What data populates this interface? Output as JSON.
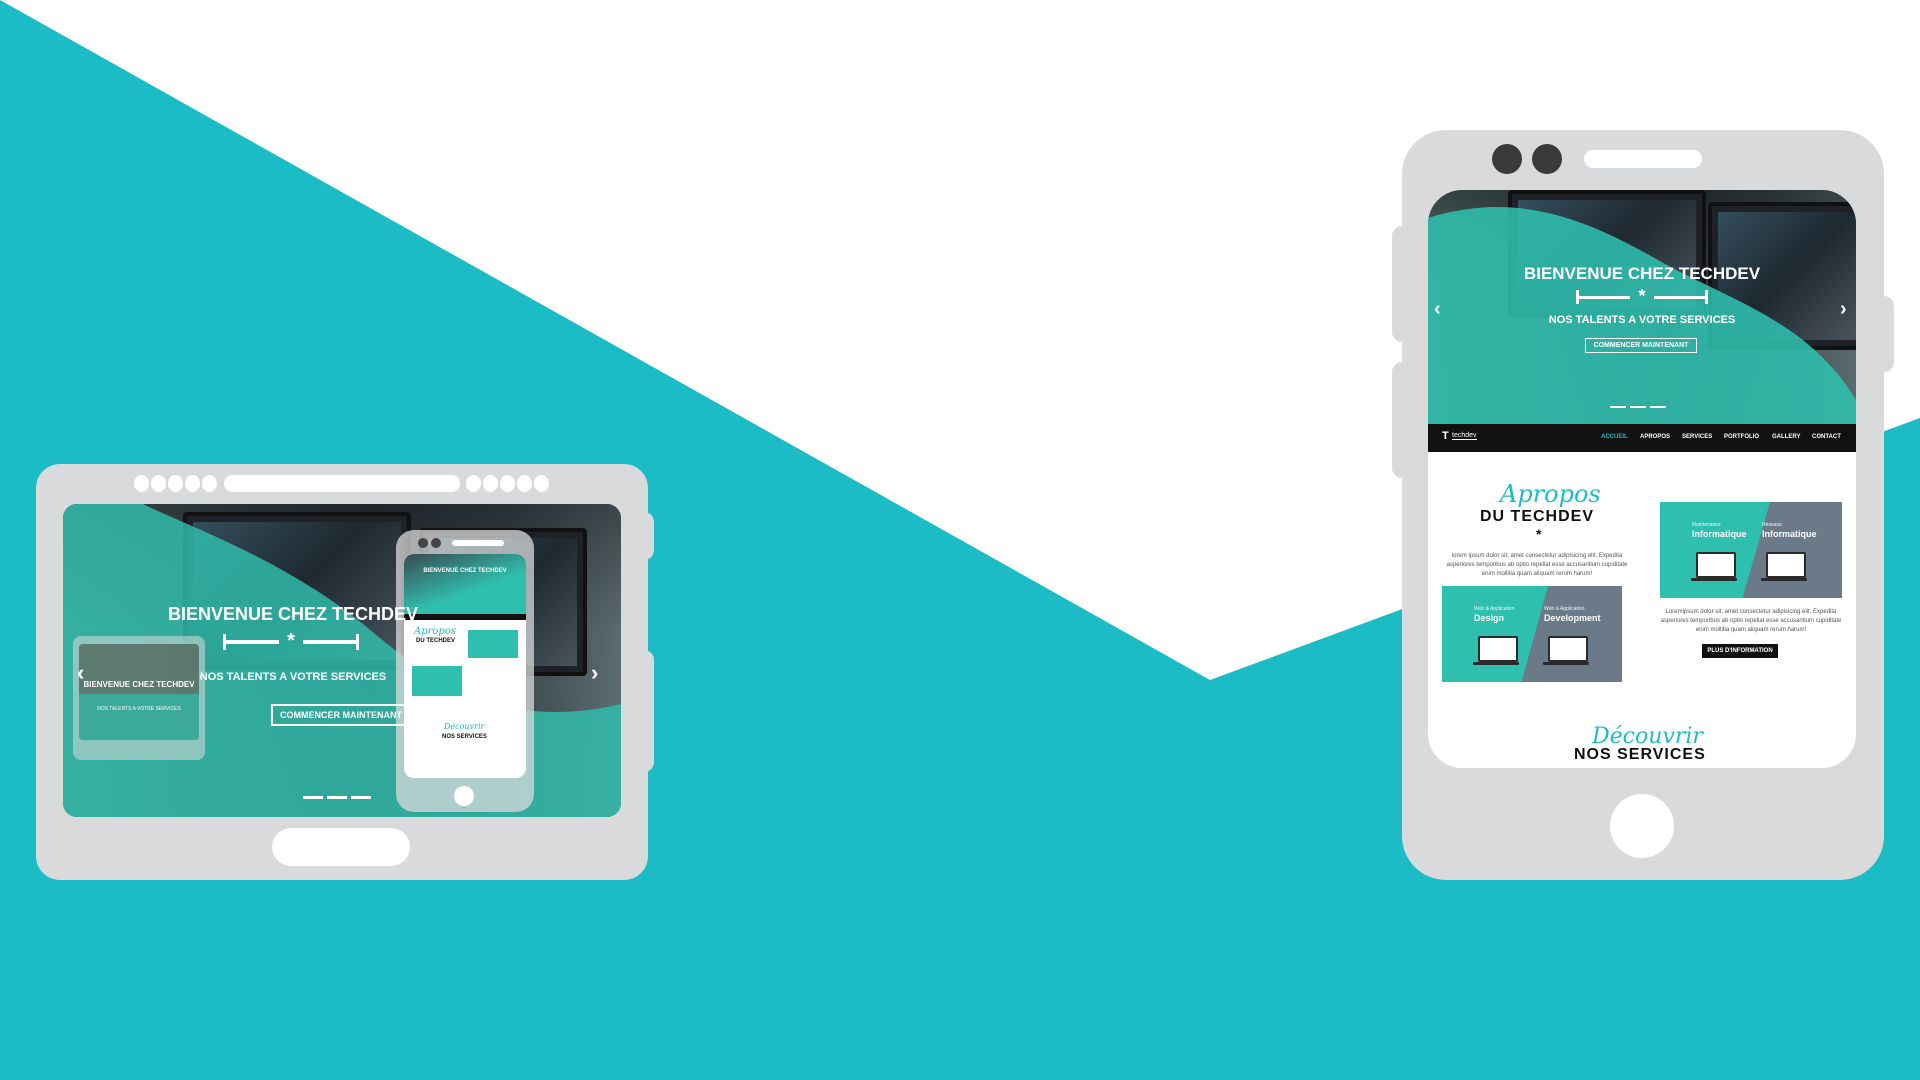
{
  "colors": {
    "teal": "#1bbcc5",
    "device_gray": "#d9dadb",
    "hero_teal": "#2fbfae",
    "slate": "#6b7a89"
  },
  "tablet": {
    "hero_title": "BIENVENUE CHEZ TECHDEV",
    "hero_subtitle": "NOS TALENTS A VOTRE SERVICES",
    "cta_label": "COMMENCER MAINTENANT",
    "ornament": "*",
    "prev_arrow": "‹",
    "next_arrow": "›",
    "mini_title": "BIENVENUE CHEZ TECHDEV",
    "mini_subtitle": "NOS TALENTS A VOTRE SERVICES",
    "mini_phone_title": "BIENVENUE CHEZ TECHDEV",
    "mini_apropos": "Apropos",
    "mini_du_techdev": "DU TECHDEV",
    "mini_decouvrir": "Découvrir",
    "mini_nos_services": "NOS SERVICES"
  },
  "phone": {
    "hero_title": "BIENVENUE CHEZ TECHDEV",
    "hero_subtitle": "NOS TALENTS A VOTRE SERVICES",
    "cta_label": "COMMENCER MAINTENANT",
    "ornament": "*",
    "prev_arrow": "‹",
    "next_arrow": "›",
    "logo_letter": "T",
    "logo_text": "techdev",
    "nav": [
      "ACCUEIL",
      "APROPOS",
      "SERVICES",
      "PORTFOLIO",
      "GALLERY",
      "CONTACT"
    ],
    "apropos_script": "Apropos",
    "apropos_heading": "DU TECHDEV",
    "apropos_star": "*",
    "lorem_1": "lorem ipsum dolor sit, amet consectetur adipisicing elit. Expedita asperiores temporibus ab optio repellat esse accusantium cupiditate enim mollitia quam aliquam rerum harum!",
    "lorem_2": "Loremipsum dolor sit, amet consectetur adipisicing elit. Expedita asperiores temporibus ab optio repellat esse accusantium cupiditate enim mollitia quam aliquam rerum harum!",
    "more_button": "PLUS D'INFORMATION",
    "card_top": {
      "left_small": "Maintenance",
      "left_big": "Informatique",
      "right_small": "Réseaux",
      "right_big": "Informatique"
    },
    "card_bottom": {
      "left_small": "Web & Application",
      "left_big": "Design",
      "right_small": "Web & Application",
      "right_big": "Development"
    },
    "services_script": "Découvrir",
    "services_heading": "NOS SERVICES"
  }
}
